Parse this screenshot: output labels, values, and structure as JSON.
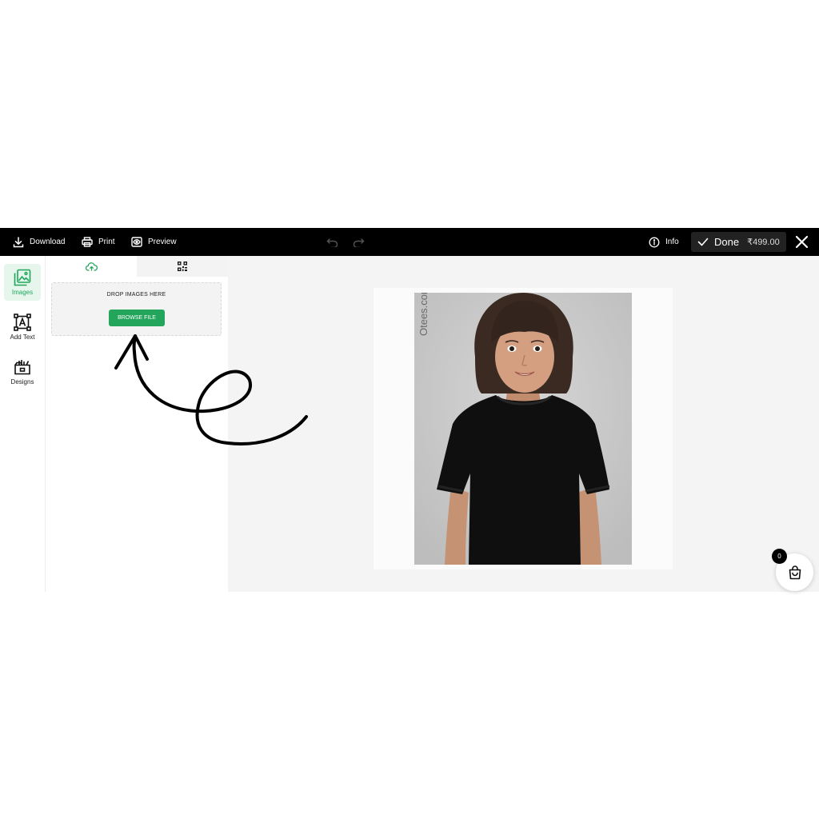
{
  "toolbar": {
    "download_label": "Download",
    "print_label": "Print",
    "preview_label": "Preview",
    "info_label": "Info",
    "done_label": "Done",
    "price": "₹499.00"
  },
  "sidebar": {
    "items": [
      {
        "label": "Images",
        "icon": "images-icon",
        "active": true
      },
      {
        "label": "Add Text",
        "icon": "text-box-icon",
        "active": false
      },
      {
        "label": "Designs",
        "icon": "designs-icon",
        "active": false
      }
    ]
  },
  "upload_panel": {
    "tabs": [
      {
        "icon": "cloud-upload-icon",
        "active": true
      },
      {
        "icon": "qr-code-icon",
        "active": false
      }
    ],
    "drop_label": "DROP IMAGES HERE",
    "browse_label": "BROWSE FILE"
  },
  "canvas": {
    "watermark": "Otees.com"
  },
  "cart": {
    "count": "0"
  },
  "colors": {
    "accent": "#23a65b",
    "topbar": "#000000",
    "canvas_bg": "#f4f4f4"
  }
}
